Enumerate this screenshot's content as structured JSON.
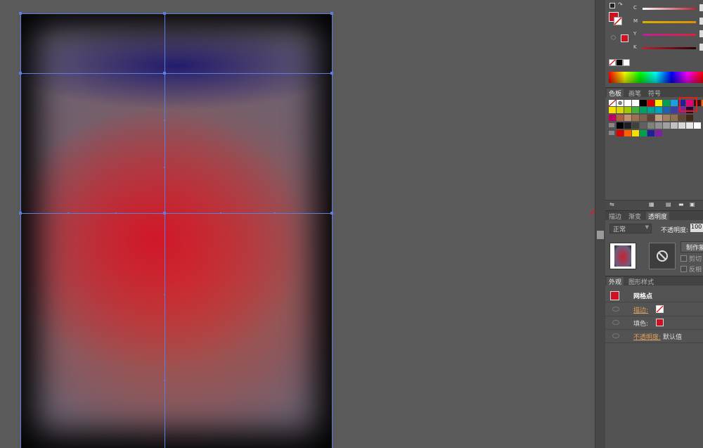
{
  "colors": {
    "fill": "#cc1122",
    "mesh_line": "#5b7fe0",
    "highlight_box": "#e02020",
    "arrow": "#d42020",
    "accent_orange": "#e0a060"
  },
  "color_panel": {
    "sliders": [
      {
        "label": "C",
        "gradient": "#c02030"
      },
      {
        "label": "M",
        "gradient": "#d4a000"
      },
      {
        "label": "Y",
        "gradient": "#c0209a"
      },
      {
        "label": "K",
        "gradient": "#901020"
      }
    ]
  },
  "swatches_tabs": {
    "tabs": [
      "色板",
      "画笔",
      "符号"
    ]
  },
  "swatch_rows": [
    [
      "#ffffff",
      "#ffffff",
      "#000000",
      "#e00000",
      "#ffee00",
      "#00a050",
      "#1aa0e0",
      "#20209a",
      "#e0007a",
      "#4a0a0a",
      "#ff6000"
    ],
    [
      "#f5e000",
      "#d8d800",
      "#a0c800",
      "#40b040",
      "#00a060",
      "#00a090",
      "#00a0c0",
      "#2060b0",
      "#4040a0",
      "#8020a0",
      "#300030"
    ],
    [
      "#c00060",
      "#b06040",
      "#c09070",
      "#a07050",
      "#806050",
      "#604030",
      "#c0a080",
      "#a08060",
      "#907050",
      "#604830",
      "#402818"
    ],
    [
      "#000000",
      "#202020",
      "#404040",
      "#606060",
      "#808080",
      "#909090",
      "#a0a0a0",
      "#c0c0c0",
      "#d8d8d8",
      "#e8e8e8",
      "#ffffff"
    ],
    [
      "#e00000",
      "#ff6000",
      "#f5e000",
      "#00a050",
      "#20209a",
      "#8020a0"
    ]
  ],
  "transparency": {
    "tabs": [
      "描边",
      "渐变",
      "透明度"
    ],
    "blend_mode": "正常",
    "opacity_label": "不透明度:",
    "opacity_value": "100",
    "make_mask_button": "制作蒙",
    "clip_label": "剪切",
    "invert_label": "反相"
  },
  "appearance": {
    "tabs": [
      "外观",
      "图形样式"
    ],
    "object_title": "网格点",
    "rows": [
      {
        "label": "描边:",
        "color": "#e0a060"
      },
      {
        "label": "填色:",
        "color": "#dddddd"
      },
      {
        "label": "不透明度:",
        "color": "#e0a060",
        "value": "默认值"
      }
    ]
  }
}
